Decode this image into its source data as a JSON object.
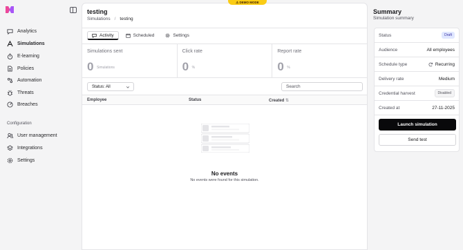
{
  "demo_badge": "⚠ DEMO MODE",
  "sidebar": {
    "items": [
      {
        "label": "Analytics",
        "icon": "chat-icon"
      },
      {
        "label": "Simulations",
        "icon": "target-icon"
      },
      {
        "label": "E-learning",
        "icon": "timer-icon"
      },
      {
        "label": "Policies",
        "icon": "document-icon"
      },
      {
        "label": "Automation",
        "icon": "automation-icon"
      },
      {
        "label": "Threats",
        "icon": "bug-icon"
      },
      {
        "label": "Breaches",
        "icon": "gauge-icon"
      }
    ],
    "section_label": "Configuration",
    "config_items": [
      {
        "label": "User management",
        "icon": "users-icon"
      },
      {
        "label": "Integrations",
        "icon": "layers-icon"
      },
      {
        "label": "Settings",
        "icon": "gear-icon"
      }
    ]
  },
  "header": {
    "title": "testing",
    "breadcrumb": [
      "Simulations",
      "/",
      "testing"
    ]
  },
  "tabs": [
    "Activity",
    "Scheduled",
    "Settings"
  ],
  "stats": [
    {
      "label": "Simulations sent",
      "value": "0",
      "unit": "Simulations"
    },
    {
      "label": "Click rate",
      "value": "0",
      "unit": "%"
    },
    {
      "label": "Report rate",
      "value": "0",
      "unit": "%"
    }
  ],
  "filter": {
    "label": "Status: All"
  },
  "search": {
    "placeholder": "Search"
  },
  "table": {
    "columns": [
      "Employee",
      "Status",
      "Created"
    ]
  },
  "empty": {
    "title": "No events",
    "subtitle": "No events were found for this simulation."
  },
  "summary": {
    "title": "Summary",
    "subtitle": "Simulation summary",
    "rows": [
      {
        "key": "Status",
        "value": "Draft"
      },
      {
        "key": "Audience",
        "value": "All employees"
      },
      {
        "key": "Schedule type",
        "value": "Recurring"
      },
      {
        "key": "Delivery rate",
        "value": "Medium"
      },
      {
        "key": "Credential harvest",
        "value": "Disabled"
      },
      {
        "key": "Created at",
        "value": "27-11-2025"
      }
    ],
    "launch_label": "Launch simulation",
    "send_test_label": "Send test"
  },
  "colors": {
    "accent": "#09090b",
    "demo": "#facc15",
    "draft_badge": "#e0e7ff"
  }
}
